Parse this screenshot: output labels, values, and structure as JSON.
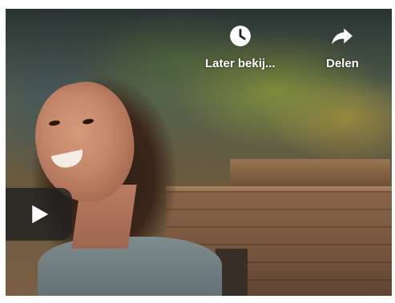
{
  "video": {
    "actions": {
      "watch_later": {
        "label": "Later bekij...",
        "icon": "clock-icon"
      },
      "share": {
        "label": "Delen",
        "icon": "share-arrow-icon"
      }
    },
    "play": {
      "icon": "play-icon"
    }
  },
  "colors": {
    "overlay_text": "#ffffff",
    "play_button_bg": "#212121"
  }
}
